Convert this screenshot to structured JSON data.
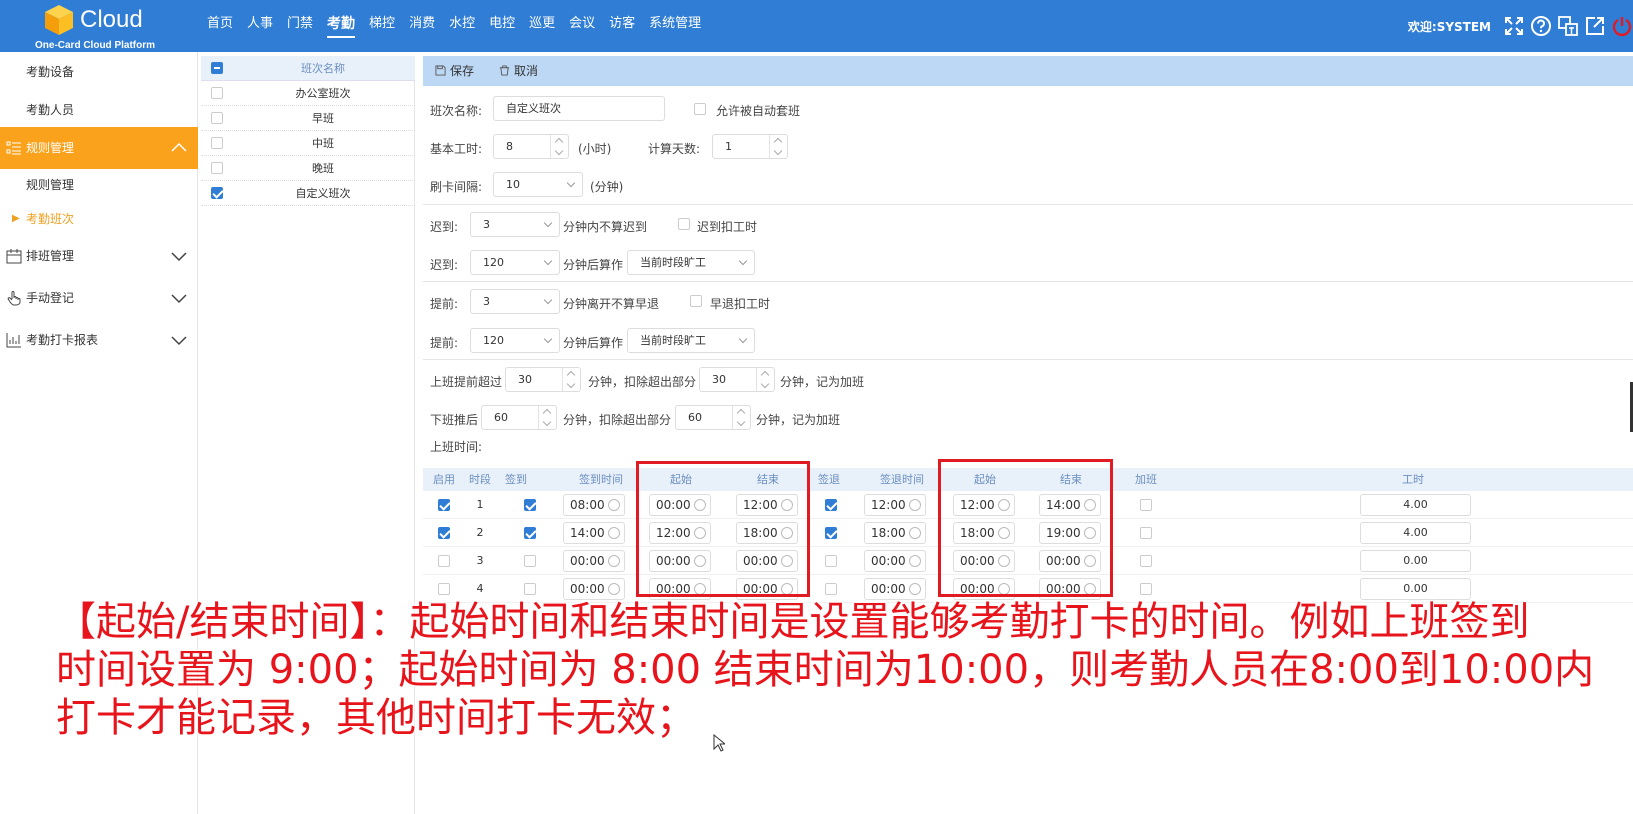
{
  "header": {
    "brand": "Cloud",
    "subtitle": "One-Card Cloud Platform",
    "welcome": "欢迎:SYSTEM",
    "nav": [
      "首页",
      "人事",
      "门禁",
      "考勤",
      "梯控",
      "消费",
      "水控",
      "电控",
      "巡更",
      "会议",
      "访客",
      "系统管理"
    ],
    "active_nav": "考勤"
  },
  "sidebar": {
    "items": [
      {
        "label": "考勤设备",
        "type": "sub"
      },
      {
        "label": "考勤人员",
        "type": "sub"
      },
      {
        "label": "规则管理",
        "type": "section-open"
      },
      {
        "label": "规则管理",
        "type": "sub"
      },
      {
        "label": "考勤班次",
        "type": "current"
      },
      {
        "label": "排班管理",
        "type": "section"
      },
      {
        "label": "手动登记",
        "type": "section"
      },
      {
        "label": "考勤打卡报表",
        "type": "section"
      }
    ]
  },
  "shift_list": {
    "header": "班次名称",
    "rows": [
      {
        "name": "办公室班次",
        "checked": false
      },
      {
        "name": "早班",
        "checked": false
      },
      {
        "name": "中班",
        "checked": false
      },
      {
        "name": "晚班",
        "checked": false
      },
      {
        "name": "自定义班次",
        "checked": true
      }
    ]
  },
  "toolbar": {
    "save": "保存",
    "cancel": "取消"
  },
  "form": {
    "shift_name_label": "班次名称:",
    "shift_name": "自定义班次",
    "auto_match": "允许被自动套班",
    "base_hours_label": "基本工时:",
    "base_hours": "8",
    "hours_unit": "(小时)",
    "days_label": "计算天数:",
    "days": "1",
    "interval_label": "刷卡间隔:",
    "interval": "10",
    "minutes_unit": "(分钟)",
    "late_label": "迟到:",
    "late1": "3",
    "late1_text": "分钟内不算迟到",
    "late_deduct": "迟到扣工时",
    "late2": "120",
    "late2_text": "分钟后算作",
    "late2_select": "当前时段旷工",
    "early_label": "提前:",
    "early1": "3",
    "early1_text": "分钟离开不算早退",
    "early_deduct": "早退扣工时",
    "early2": "120",
    "early2_text": "分钟后算作",
    "early2_select": "当前时段旷工",
    "ot_before_label": "上班提前超过",
    "ot_before": "30",
    "ot_before_text": "分钟，扣除超出部分",
    "ot_before2": "30",
    "ot_before2_text": "分钟，记为加班",
    "ot_after_label": "下班推后",
    "ot_after": "60",
    "ot_after_text": "分钟，扣除超出部分",
    "ot_after2": "60",
    "ot_after2_text": "分钟，记为加班",
    "work_time_label": "上班时间:"
  },
  "table": {
    "headers": [
      "启用",
      "时段",
      "签到",
      "签到时间",
      "起始",
      "结束",
      "签退",
      "签退时间",
      "起始",
      "结束",
      "加班",
      "工时"
    ],
    "rows": [
      {
        "enabled": true,
        "no": "1",
        "signin": true,
        "signin_time": "08:00",
        "in_start": "00:00",
        "in_end": "12:00",
        "signout": true,
        "signout_time": "12:00",
        "out_start": "12:00",
        "out_end": "14:00",
        "ot": false,
        "hours": "4.00"
      },
      {
        "enabled": true,
        "no": "2",
        "signin": true,
        "signin_time": "14:00",
        "in_start": "12:00",
        "in_end": "18:00",
        "signout": true,
        "signout_time": "18:00",
        "out_start": "18:00",
        "out_end": "19:00",
        "ot": false,
        "hours": "4.00"
      },
      {
        "enabled": false,
        "no": "3",
        "signin": false,
        "signin_time": "00:00",
        "in_start": "00:00",
        "in_end": "00:00",
        "signout": false,
        "signout_time": "00:00",
        "out_start": "00:00",
        "out_end": "00:00",
        "ot": false,
        "hours": "0.00"
      },
      {
        "enabled": false,
        "no": "4",
        "signin": false,
        "signin_time": "00:00",
        "in_start": "00:00",
        "in_end": "00:00",
        "signout": false,
        "signout_time": "00:00",
        "out_start": "00:00",
        "out_end": "00:00",
        "ot": false,
        "hours": "0.00"
      }
    ]
  },
  "caption": {
    "lines": [
      "【起始/结束时间】：起始时间和结束时间是设置能够考勤打卡的时间。例如上班签到",
      "时间设置为 9:00；起始时间为 8:00 结束时间为10:00，则考勤人员在8:00到10:00内",
      "打卡才能记录，其他时间打卡无效；"
    ]
  },
  "colors": {
    "header": "#2f7dd4",
    "active_menu": "#fba21c",
    "highlight_box": "#e01b24",
    "caption": "#e8141c"
  }
}
